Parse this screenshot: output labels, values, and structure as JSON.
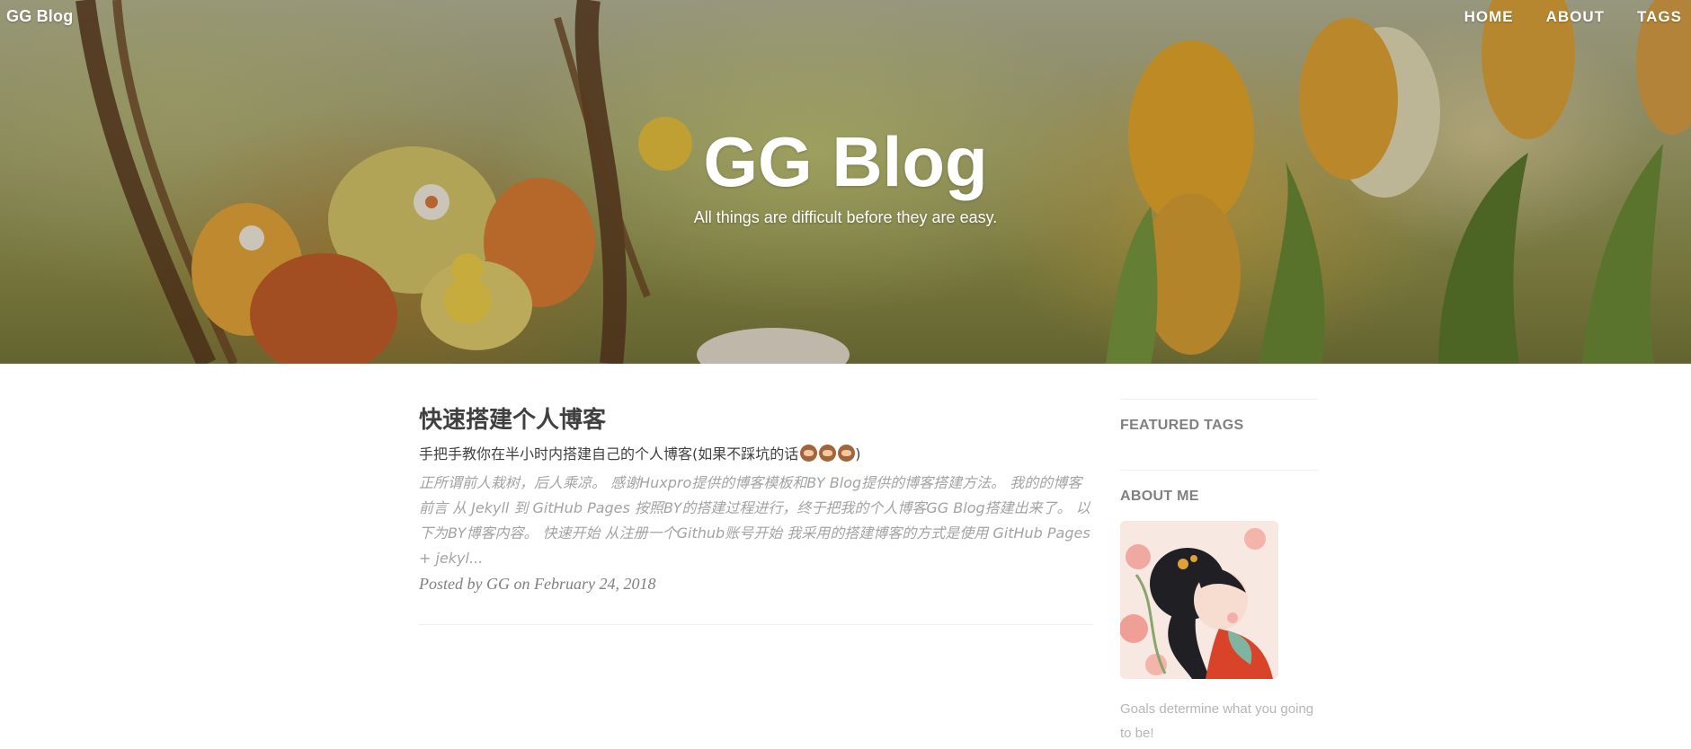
{
  "header": {
    "brand": "GG Blog",
    "nav": [
      {
        "label": "HOME"
      },
      {
        "label": "ABOUT"
      },
      {
        "label": "TAGS"
      }
    ],
    "site_title": "GG Blog",
    "site_subtitle": "All things are difficult before they are easy."
  },
  "post": {
    "title": "快速搭建个人博客",
    "subtitle": "手把手教你在半小时内搭建自己的个人博客(如果不踩坑的话",
    "subtitle_close": ")",
    "emojis": [
      "see-no-evil-monkey-icon",
      "hear-no-evil-monkey-icon",
      "speak-no-evil-monkey-icon"
    ],
    "excerpt": "正所谓前人栽树，后人乘凉。 感谢Huxpro提供的博客模板和BY Blog提供的博客搭建方法。 我的的博客 前言 从 Jekyll 到 GitHub Pages 按照BY的搭建过程进行，终于把我的个人博客GG Blog搭建出来了。 以下为BY博客内容。 快速开始 从注册一个Github账号开始 我采用的搭建博客的方式是使用 GitHub Pages + jekyl...",
    "meta": "Posted by GG on February 24, 2018"
  },
  "sidebar": {
    "featured_tags_heading": "FEATURED TAGS",
    "about_heading": "ABOUT ME",
    "about_text": "Goals determine what you going to be!"
  },
  "colors": {
    "text": "#404040",
    "muted": "#808080",
    "excerpt": "#a3a3a3",
    "rule": "#eeeeee"
  }
}
